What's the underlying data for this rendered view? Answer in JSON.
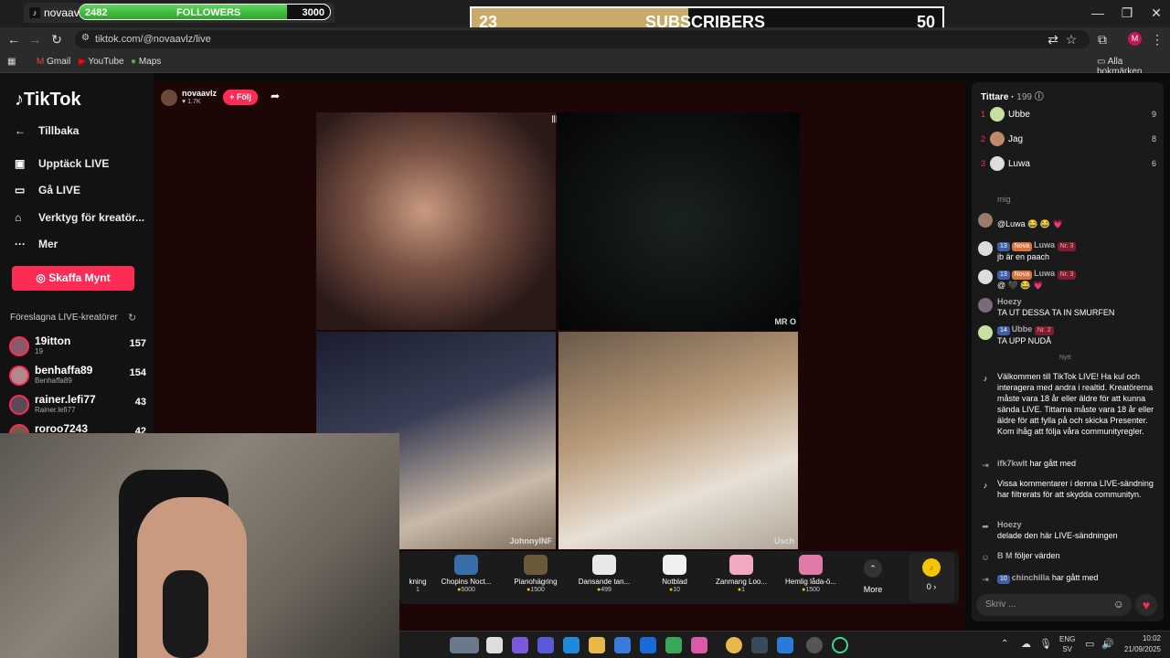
{
  "browser": {
    "tab_title": "novaavlz (c",
    "url": "tiktok.com/@novaavlz/live",
    "bookmarks": [
      "Gmail",
      "YouTube",
      "Maps"
    ],
    "all_bookmarks": "Alla bokmärken",
    "profile_initial": "M"
  },
  "overlays": {
    "followers": {
      "current": "2482",
      "label": "FOLLOWERS",
      "goal": "3000",
      "progress": 0.827
    },
    "subscribers": {
      "current": "23",
      "label": "SUBSCRIBERS",
      "goal": "50",
      "progress": 0.46
    }
  },
  "sidebar": {
    "logo": "TikTok",
    "back": "Tillbaka",
    "items": [
      {
        "label": "Upptäck LIVE",
        "icon": "calendar-live-icon"
      },
      {
        "label": "Gå LIVE",
        "icon": "video-camera-icon"
      },
      {
        "label": "Verktyg för kreatör...",
        "icon": "creator-tools-icon"
      },
      {
        "label": "Mer",
        "icon": "more-dots-icon"
      }
    ],
    "coins_button": "Skaffa Mynt",
    "suggested_title": "Föreslagna LIVE-kreatörer",
    "creators": [
      {
        "name": "19itton",
        "sub": "19",
        "count": "157"
      },
      {
        "name": "benhaffa89",
        "sub": "Benhaffa89",
        "count": "154"
      },
      {
        "name": "rainer.lefi77",
        "sub": "Rainer.lefi77",
        "count": "43"
      },
      {
        "name": "roroo7243",
        "sub": "",
        "count": "42"
      }
    ]
  },
  "stream": {
    "host_name": "novaavlz",
    "host_likes": "1.7K",
    "follow_label": "+ Följ",
    "tiles": [
      {
        "label": ""
      },
      {
        "label": "MR O"
      },
      {
        "label": "JohnnyINF"
      },
      {
        "label": "Usch"
      }
    ]
  },
  "gifts": [
    {
      "name": "kning",
      "price": "1"
    },
    {
      "name": "Chopins Noct...",
      "price": "5000"
    },
    {
      "name": "Pianohägring",
      "price": "1500"
    },
    {
      "name": "Dansande tan...",
      "price": "499"
    },
    {
      "name": "Notblad",
      "price": "10"
    },
    {
      "name": "Zanmang Loo...",
      "price": "1"
    },
    {
      "name": "Hemlig låda-ö...",
      "price": "1500"
    }
  ],
  "more_label": "More",
  "coin_balance": "0 ›",
  "panel": {
    "viewers_label": "Tittare",
    "viewers_count": "199",
    "top": [
      {
        "rank": "1",
        "name": "Ubbe",
        "score": "9"
      },
      {
        "rank": "2",
        "name": "Jag",
        "score": "8"
      },
      {
        "rank": "3",
        "name": "Luwa",
        "score": "6"
      }
    ],
    "chat": {
      "m0": "mig",
      "m1": "@Luwa 😂 😂 💗",
      "m2_user": "Luwa",
      "m2_badge1": "13",
      "m2_badge2": "Nova",
      "m2_badge3": "Nr. 3",
      "m2_text": "jb är en paach",
      "m3_user": "Luwa",
      "m3_text": "@ 🖤 😂 💗",
      "m4_user": "Hoezy",
      "m4_text": "TA UT DESSA TA IN SMURFEN",
      "m5_user": "Ubbe",
      "m5_badge1": "14",
      "m5_badge3": "Nr. 2",
      "m5_text": "TA UPP NUDÅ",
      "new_divider": "Nytt",
      "welcome": "Välkommen till TikTok LIVE! Ha kul och interagera med andra i realtid. Kreatörerna måste vara 18 år eller äldre för att kunna sända LIVE. Tittarna måste vara 18 år eller äldre för att fylla på och skicka Presenter. Kom ihåg att följa våra communityregler.",
      "join1_user": "ifk7kwlt",
      "join1_text": "har gått med",
      "filter": "Vissa kommentarer i denna LIVE-sändning har filtrerats för att skydda communityn.",
      "share_user": "Hoezy",
      "share_text": "delade den här LIVE-sändningen",
      "follow_user": "B M",
      "follow_text": "följer värden",
      "join2_badge": "10",
      "join2_user": "chinchilla",
      "join2_text": "har gått med"
    },
    "input_placeholder": "Skriv ..."
  },
  "taskbar": {
    "lang1": "ENG",
    "lang2": "SV",
    "time": "10:02",
    "date": "21/09/2025"
  },
  "colors": {
    "accent": "#fe2c55",
    "followers_bar": "#3bbf38",
    "subs_bar": "#c8ab6b"
  }
}
